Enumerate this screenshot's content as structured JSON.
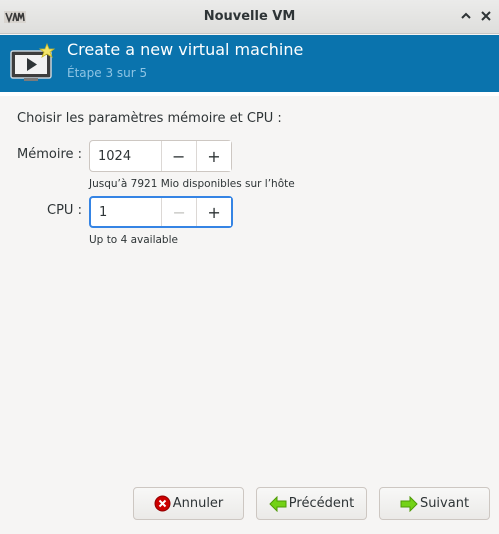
{
  "window": {
    "title": "Nouvelle VM",
    "app_icon": "vm-logo-icon",
    "maximize_icon": "chevron-up-icon",
    "close_icon": "close-icon"
  },
  "banner": {
    "title": "Create a new virtual machine",
    "step": "Étape 3 sur 5",
    "icon": "monitor-play-new-icon",
    "color": "#0a73ad"
  },
  "main": {
    "heading": "Choisir les paramètres mémoire et CPU :",
    "memory": {
      "label": "Mémoire :",
      "value": "1024",
      "decrement": "−",
      "increment": "+",
      "hint": "Jusqu’à 7921 Mio disponibles sur l’hôte"
    },
    "cpu": {
      "label": "CPU :",
      "value": "1",
      "decrement": "−",
      "increment": "+",
      "hint": "Up to 4 available"
    }
  },
  "footer": {
    "cancel": {
      "label": "Annuler",
      "icon": "cancel-icon"
    },
    "back": {
      "label": "Précédent",
      "icon": "arrow-left-icon"
    },
    "forward": {
      "label": "Suivant",
      "icon": "arrow-right-icon"
    }
  },
  "colors": {
    "accent": "#3584e4",
    "arrow_green": "#4e9a06",
    "cancel_red": "#cc0000"
  }
}
